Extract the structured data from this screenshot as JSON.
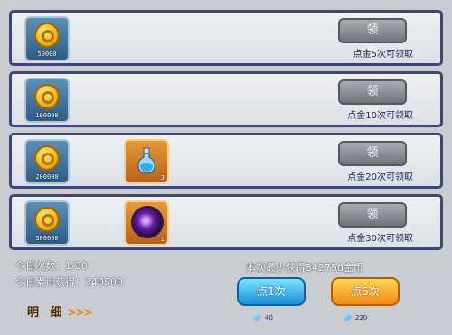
{
  "rows": [
    {
      "coin_amount": "50000",
      "claim_label": "领 取",
      "requirement": "点金5次可领取"
    },
    {
      "coin_amount": "100000",
      "claim_label": "领 取",
      "requirement": "点金10次可领取"
    },
    {
      "coin_amount": "200000",
      "item_qty": "3",
      "item_icon": "potion-icon",
      "claim_label": "领 取",
      "requirement": "点金20次可领取"
    },
    {
      "coin_amount": "300000",
      "item_qty": "1",
      "item_icon": "purple-orb-icon",
      "claim_label": "领 取",
      "requirement": "点金30次可领取"
    }
  ],
  "stats": {
    "today_count": "今日次数：1/30",
    "today_total": "今日累计获得：340500",
    "min_gain": "本次最少获得34275ö金币"
  },
  "detail_label": "明 细",
  "buttons": {
    "once_label": "点1次",
    "once_cost": "40",
    "five_label": "点5次",
    "five_cost": "220"
  },
  "colors": {
    "row_border": "#3d4775",
    "claim_button": "#8a8d93",
    "once_button": "#3bb6f0",
    "five_button": "#f6a622"
  }
}
